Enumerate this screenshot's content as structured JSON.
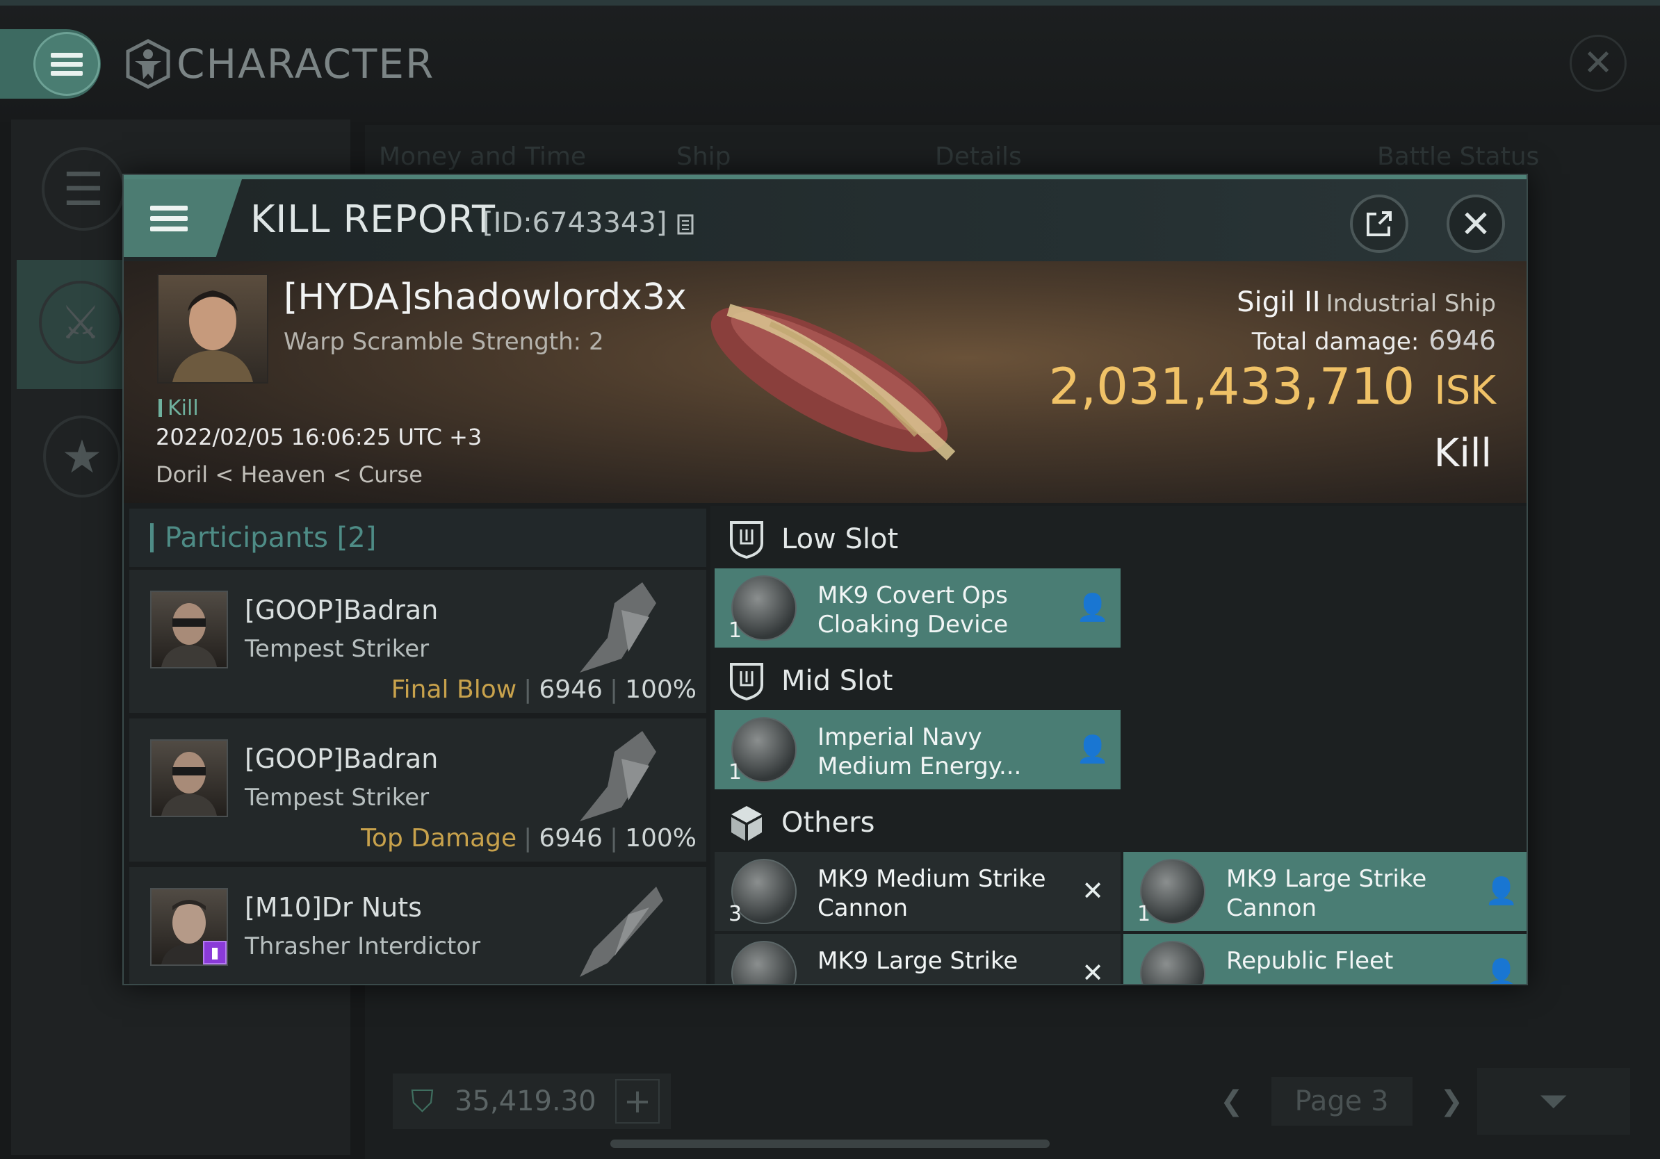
{
  "app": {
    "title": "CHARACTER",
    "tabs": [
      "Money and Time",
      "Ship",
      "Details",
      "Battle Status"
    ],
    "wallet_value": "35,419.30",
    "page_label": "Page 3"
  },
  "dialog": {
    "title": "KILL REPORT",
    "id_label": "[ID:6743343]",
    "victim": {
      "name": "[HYDA]shadowlordx3x",
      "subtitle": "Warp Scramble Strength: 2",
      "tag": "Kill",
      "datetime": "2022/02/05 16:06:25 UTC +3",
      "location": "Doril < Heaven < Curse",
      "ship_name": "Sigil II",
      "ship_class": "Industrial Ship",
      "total_damage_label": "Total damage:",
      "total_damage": "6946",
      "isk_value": "2,031,433,710",
      "isk_unit": "ISK",
      "result": "Kill"
    },
    "participants": {
      "header": "Participants [2]",
      "rows": [
        {
          "name": "[GOOP]Badran",
          "ship": "Tempest Striker",
          "tag": "Final Blow",
          "damage": "6946",
          "percent": "100%"
        },
        {
          "name": "[GOOP]Badran",
          "ship": "Tempest Striker",
          "tag": "Top Damage",
          "damage": "6946",
          "percent": "100%"
        },
        {
          "name": "[M10]Dr Nuts",
          "ship": "Thrasher Interdictor"
        }
      ]
    },
    "fitting": {
      "low_slot_label": "Low Slot",
      "mid_slot_label": "Mid Slot",
      "others_label": "Others",
      "low": [
        {
          "name": "MK9 Covert Ops Cloaking Device",
          "qty": "1",
          "status": "dropped"
        }
      ],
      "mid": [
        {
          "name": "Imperial Navy Medium Energy...",
          "qty": "1",
          "status": "dropped"
        }
      ],
      "others": [
        {
          "name": "MK9 Medium Strike Cannon",
          "qty": "3",
          "status": "destroyed"
        },
        {
          "name": "MK9 Large Strike Cannon",
          "qty": "1",
          "status": "dropped"
        },
        {
          "name": "MK9 Large Strike",
          "qty": "",
          "status": "destroyed"
        },
        {
          "name": "Republic Fleet",
          "qty": "",
          "status": "dropped"
        }
      ]
    }
  },
  "colors": {
    "accent": "#4a7d74",
    "isk_gold": "#f0c267",
    "tag_gold": "#c8a24c",
    "teal_text": "#4e8c86"
  }
}
